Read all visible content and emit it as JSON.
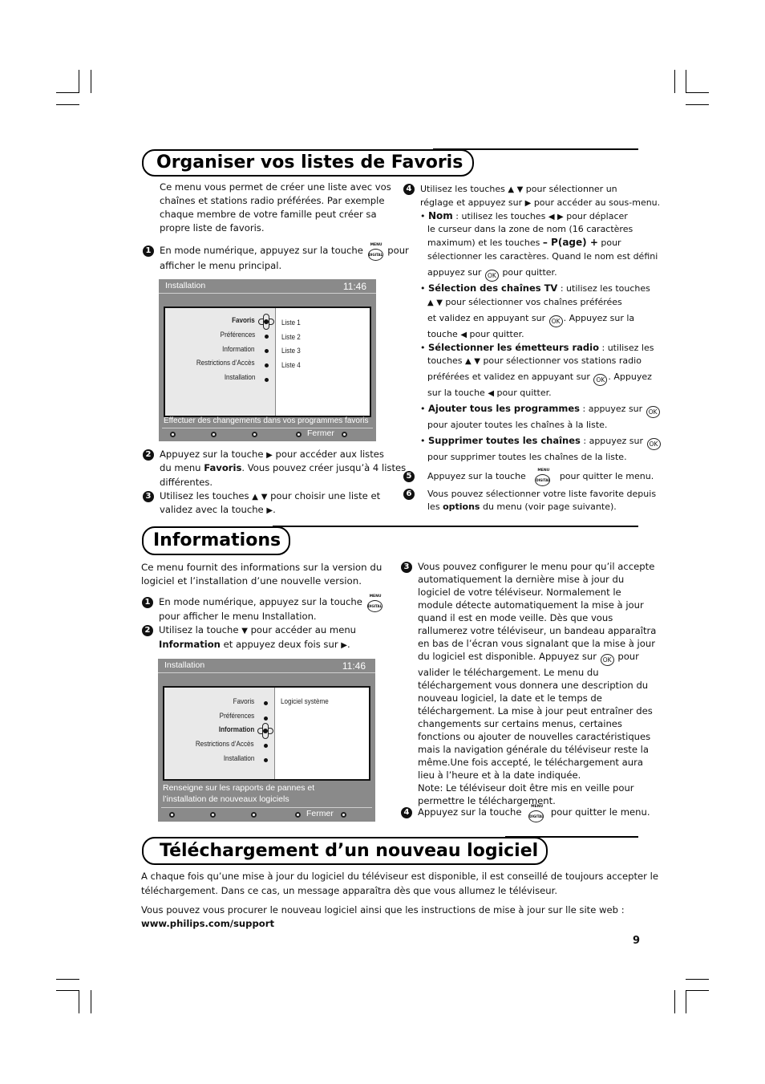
{
  "page_number": "9",
  "sections": {
    "favoris": {
      "title": "Organiser vos listes de Favoris",
      "intro": [
        "Ce menu vous permet de créer une liste avec vos",
        "chaînes et stations radio préférées. Par exemple",
        "chaque membre de votre famille peut créer sa",
        "propre liste de favoris."
      ],
      "step1": {
        "num": "1",
        "a": "En mode numérique, appuyez sur la touche",
        "b": "pour",
        "c": "afficher le menu principal."
      },
      "step2": {
        "num": "2",
        "l1a": "Appuyez sur la touche",
        "l1b": "pour accéder aux listes",
        "l2a": "du menu",
        "l2b": "Favoris",
        "l2c": ". Vous pouvez créer jusqu’à 4 listes",
        "l3": "différentes."
      },
      "step3": {
        "num": "3",
        "l1a": "Utilisez les touches",
        "l1b": "pour choisir une liste et",
        "l2": "validez avec la touche"
      },
      "step4": {
        "num": "4",
        "l1a": "Utilisez les touches",
        "l1b": "pour sélectionner un",
        "l2a": "réglage et appuyez sur",
        "l2b": "pour accéder au sous-menu.",
        "nom": {
          "label": "Nom",
          "l1a": " : utilisez les touches",
          "l1b": "pour déplacer",
          "l2": "le curseur dans la zone de nom (16 caractères",
          "l3a": "maximum) et les touches",
          "l3b": "– P(age) +",
          "l3c": "pour",
          "l4": "sélectionner les caractères. Quand le nom est défini",
          "l5a": "appuyez sur",
          "l5b": "pour quitter."
        },
        "tv": {
          "label": "Sélection des chaînes TV",
          "l1a": " : utilisez les touches",
          "l2": "pour sélectionner vos chaînes préférées",
          "l3a": "et validez en appuyant sur",
          "l3b": ". Appuyez sur la",
          "l4a": "touche",
          "l4b": "pour quitter."
        },
        "radio": {
          "label": "Sélectionner les émetteurs radio",
          "l1a": " : utilisez les",
          "l2a": "touches",
          "l2b": "pour sélectionner vos stations radio",
          "l3a": "préférées et validez en appuyant sur",
          "l3b": ".  Appuyez",
          "l4a": "sur la touche",
          "l4b": "pour quitter."
        },
        "add": {
          "label": "Ajouter tous les programmes",
          "l1a": " : appuyez sur",
          "l2": "pour ajouter toutes les chaînes à la liste."
        },
        "del": {
          "label": "Supprimer toutes les chaînes",
          "l1a": " : appuyez sur",
          "l2": "pour supprimer toutes les chaînes de la liste."
        }
      },
      "step5": {
        "num": "5",
        "a": "Appuyez sur la touche",
        "b": "pour quitter le menu."
      },
      "step6": {
        "num": "6",
        "l1": "Vous pouvez sélectionner votre liste favorite depuis",
        "l2a": "les",
        "l2b": "options",
        "l2c": "du menu (voir page suivante)."
      },
      "screen": {
        "title": "Installation",
        "clock": "11:46",
        "menu": [
          "Favoris",
          "Préférences",
          "Information",
          "Restrictions d’Accès",
          "Installation"
        ],
        "selected_index": 0,
        "submenu": [
          "Liste 1",
          "Liste 2",
          "Liste 3",
          "Liste 4"
        ],
        "status": "Effectuer des changements dans vos programmes favoris",
        "footer_label": "Fermer"
      }
    },
    "informations": {
      "title": "Informations",
      "intro": [
        "Ce menu fournit des informations sur la version du",
        "logiciel et l’installation d’une nouvelle version."
      ],
      "step1": {
        "num": "1",
        "a": "En mode numérique, appuyez sur la touche",
        "b": "pour afficher le menu Installation."
      },
      "step2": {
        "num": "2",
        "l1a": "Utilisez la touche",
        "l1b": "pour accéder au menu",
        "l2a": "Information",
        "l2b": "et appuyez deux fois sur"
      },
      "step3": {
        "num": "3",
        "lines": [
          "Vous pouvez configurer le menu pour qu’il accepte",
          "automatiquement la dernière mise à jour du",
          "logiciel de votre téléviseur. Normalement le",
          "module détecte automatiquement la mise à jour",
          "quand il est en mode veille. Dès que vous",
          "rallumerez votre téléviseur, un bandeau apparaîtra",
          "en bas de l’écran vous signalant que la mise à jour"
        ],
        "ok_line_a": "du logiciel est disponible. Appuyez sur",
        "ok_line_b": "pour",
        "lines2": [
          "valider le téléchargement. Le menu du",
          "téléchargement vous donnera une description du",
          "nouveau logiciel, la date et le temps de",
          "téléchargement. La mise à jour peut entraîner des",
          "changements sur certains menus, certaines",
          "fonctions ou ajouter de nouvelles caractéristiques",
          "mais la navigation générale du téléviseur reste la",
          "même.Une fois accepté, le téléchargement aura",
          "lieu à l’heure et à la date indiquée.",
          "Note: Le téléviseur doit être mis en veille pour",
          "permettre le téléchargement."
        ]
      },
      "step4": {
        "num": "4",
        "a": "Appuyez sur la touche",
        "b": "pour quitter le menu."
      },
      "screen": {
        "title": "Installation",
        "clock": "11:46",
        "menu": [
          "Favoris",
          "Préférences",
          "Information",
          "Restrictions d’Accès",
          "Installation"
        ],
        "selected_index": 2,
        "submenu": [
          "Logiciel système"
        ],
        "status": [
          "Renseigne sur les rapports de pannes et",
          "l’installation de nouveaux logiciels"
        ],
        "footer_label": "Fermer"
      }
    },
    "telechargement": {
      "title": "Téléchargement d’un nouveau logiciel",
      "p1": [
        "A chaque fois qu’une mise à jour du logiciel du téléviseur est disponible, il est conseillé de toujours accepter le",
        "téléchargement. Dans ce cas, un message apparaîtra dès que vous allumez le téléviseur."
      ],
      "p2": "Vous pouvez vous procurer le nouveau logiciel ainsi que les instructions de mise à jour sur lle site web :",
      "url": "www.philips.com/support"
    }
  },
  "icons": {
    "up": "▲",
    "down": "▼",
    "right": "▶",
    "left": "◀",
    "key_menu_top": "MENU",
    "key_menu_mid": "DIGITAL",
    "key_ok": "OK"
  }
}
